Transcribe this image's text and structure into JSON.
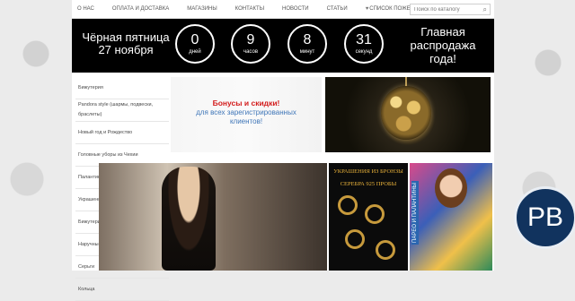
{
  "topnav": {
    "items": [
      "О нас",
      "Оплата и доставка",
      "Магазины",
      "Контакты",
      "Новости",
      "Статьи",
      "Список пожеланий"
    ],
    "search_placeholder": "Поиск по каталогу"
  },
  "banner": {
    "left_line1": "Чёрная пятница",
    "left_line2": "27 ноября",
    "counters": [
      {
        "value": "0",
        "unit": "дней"
      },
      {
        "value": "9",
        "unit": "часов"
      },
      {
        "value": "8",
        "unit": "минут"
      },
      {
        "value": "31",
        "unit": "секунд"
      }
    ],
    "right_line1": "Главная",
    "right_line2": "распродажа",
    "right_line3": "года!"
  },
  "sidebar": {
    "categories": [
      "Бижутерия",
      "Pandora style (шармы, подвески, браслеты)",
      "Новый год и Рождество",
      "Головные уборы из Чехии",
      "Палантины, шарфы, платки",
      "Украшения A&C из серебра",
      "Бижутерия из Финляндии, Kaiko",
      "Наручные часы",
      "Серьги",
      "Кольца"
    ]
  },
  "promo": {
    "red": "Бонусы и скидки!",
    "blue1": "для всех зарегистрированных",
    "blue2": "клиентов!"
  },
  "bronze_title1": "УКРАШЕНИЯ ИЗ БРОНЗЫ",
  "bronze_title2": "СЕРЕБРА 925 ПРОБЫ",
  "scarf_label": "ПАРЕО И ПАЛАНТИНЫ",
  "badge": "PB"
}
